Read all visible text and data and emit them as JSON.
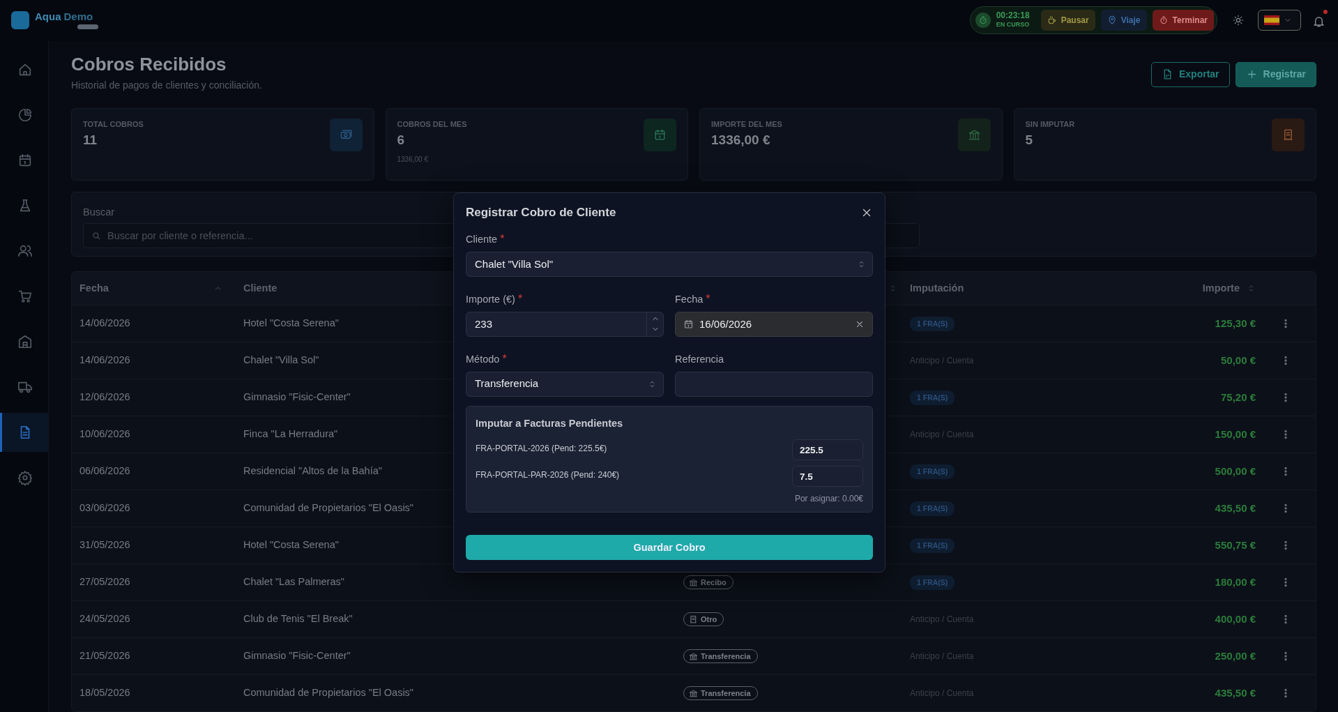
{
  "topbar": {
    "brand": {
      "name": "Aqua",
      "accent": "Demo"
    },
    "timer": {
      "time": "00:23:18",
      "status": "EN CURSO"
    },
    "actions": [
      {
        "label": "Pausar",
        "kind": "pause"
      },
      {
        "label": "Viaje",
        "kind": "trip"
      },
      {
        "label": "Terminar",
        "kind": "stop"
      }
    ],
    "notifications_unread": true
  },
  "sidebar": {
    "items": [
      {
        "kind": "home",
        "selected": false
      },
      {
        "kind": "chart",
        "selected": false
      },
      {
        "kind": "calendar",
        "selected": false
      },
      {
        "kind": "flask",
        "selected": false
      },
      {
        "kind": "users",
        "selected": false
      },
      {
        "kind": "cart",
        "selected": false
      },
      {
        "kind": "building",
        "selected": false
      },
      {
        "kind": "truck",
        "selected": false
      },
      {
        "kind": "document",
        "selected": true
      },
      {
        "kind": "settings",
        "selected": false
      }
    ]
  },
  "header": {
    "title": "Cobros Recibidos",
    "subtitle": "Historial de pagos de clientes y conciliación.",
    "buttons": [
      {
        "label": "Exportar",
        "kind": "outline"
      },
      {
        "label": "Registrar",
        "kind": "primary"
      }
    ]
  },
  "stats": [
    {
      "label": "TOTAL COBROS",
      "value": "11",
      "kind": "cash",
      "color": "#0f2236"
    },
    {
      "label": "COBROS DEL MES",
      "value": "6",
      "sub": "1336,00 €",
      "kind": "calendar",
      "color": "#0e2620"
    },
    {
      "label": "IMPORTE DEL MES",
      "value": "1336,00 €",
      "kind": "bank",
      "color": "#13221a"
    },
    {
      "label": "SIN IMPUTAR",
      "value": "5",
      "kind": "receipt",
      "color": "#2a1a14"
    }
  ],
  "search": {
    "label": "Buscar",
    "placeholder": "Buscar por cliente o referencia..."
  },
  "table": {
    "columns": [
      {
        "label": "Fecha",
        "kind": "sorted"
      },
      {
        "label": "Cliente",
        "kind": "plain"
      },
      {
        "kind": "sortable"
      },
      {
        "label": "Imputación",
        "kind": "plain"
      },
      {
        "label": "Importe",
        "kind": "sortable"
      }
    ],
    "rows": [
      {
        "date": "14/06/2026",
        "client": "Hotel \"Costa Serena\"",
        "imputation": {
          "kind": "badge",
          "text": "1 FRA(S)"
        },
        "amount": "125,30 €"
      },
      {
        "date": "14/06/2026",
        "client": "Chalet \"Villa Sol\"",
        "imputation": {
          "kind": "text",
          "text": "Anticipo / Cuenta"
        },
        "amount": "50,00 €"
      },
      {
        "date": "12/06/2026",
        "client": "Gimnasio \"Fisic-Center\"",
        "imputation": {
          "kind": "badge",
          "text": "1 FRA(S)"
        },
        "amount": "75,20 €"
      },
      {
        "date": "10/06/2026",
        "client": "Finca \"La Herradura\"",
        "imputation": {
          "kind": "text",
          "text": "Anticipo / Cuenta"
        },
        "amount": "150,00 €"
      },
      {
        "date": "06/06/2026",
        "client": "Residencial \"Altos de la Bahía\"",
        "imputation": {
          "kind": "badge",
          "text": "1 FRA(S)"
        },
        "amount": "500,00 €"
      },
      {
        "date": "03/06/2026",
        "client": "Comunidad de Propietarios \"El Oasis\"",
        "imputation": {
          "kind": "badge",
          "text": "1 FRA(S)"
        },
        "amount": "435,50 €"
      },
      {
        "date": "31/05/2026",
        "client": "Hotel \"Costa Serena\"",
        "imputation": {
          "kind": "badge",
          "text": "1 FRA(S)"
        },
        "amount": "550,75 €"
      },
      {
        "date": "27/05/2026",
        "client": "Chalet \"Las Palmeras\"",
        "method": {
          "label": "Recibo",
          "kind": "bank"
        },
        "imputation": {
          "kind": "badge",
          "text": "1 FRA(S)"
        },
        "amount": "180,00 €"
      },
      {
        "date": "24/05/2026",
        "client": "Club de Tenis \"El Break\"",
        "method": {
          "label": "Otro",
          "kind": "receipt"
        },
        "imputation": {
          "kind": "text",
          "text": "Anticipo / Cuenta"
        },
        "amount": "400,00 €"
      },
      {
        "date": "21/05/2026",
        "client": "Gimnasio \"Fisic-Center\"",
        "method": {
          "label": "Transferencia",
          "kind": "bank"
        },
        "imputation": {
          "kind": "text",
          "text": "Anticipo / Cuenta"
        },
        "amount": "250,00 €"
      },
      {
        "date": "18/05/2026",
        "client": "Comunidad de Propietarios \"El Oasis\"",
        "method": {
          "label": "Transferencia",
          "kind": "bank"
        },
        "imputation": {
          "kind": "text",
          "text": "Anticipo / Cuenta"
        },
        "amount": "435,50 €"
      }
    ]
  },
  "modal": {
    "title": "Registrar Cobro de Cliente",
    "client": {
      "label": "Cliente",
      "required_mark": "*",
      "value": "Chalet \"Villa Sol\""
    },
    "amount": {
      "label": "Importe (€)",
      "required_mark": "*",
      "value": "233"
    },
    "date": {
      "label": "Fecha",
      "required_mark": "*",
      "value": "16/06/2026"
    },
    "method": {
      "label": "Método",
      "required_mark": "*",
      "value": "Transferencia"
    },
    "reference": {
      "label": "Referencia"
    },
    "allocation": {
      "title": "Imputar a Facturas Pendientes",
      "invoices": [
        {
          "label": "FRA-PORTAL-2026 (Pend: 225.5€)",
          "value": "225.5"
        },
        {
          "label": "FRA-PORTAL-PAR-2026 (Pend: 240€)",
          "value": "7.5"
        }
      ],
      "remaining": "Por asignar: 0.00€"
    },
    "submit": "Guardar Cobro"
  }
}
